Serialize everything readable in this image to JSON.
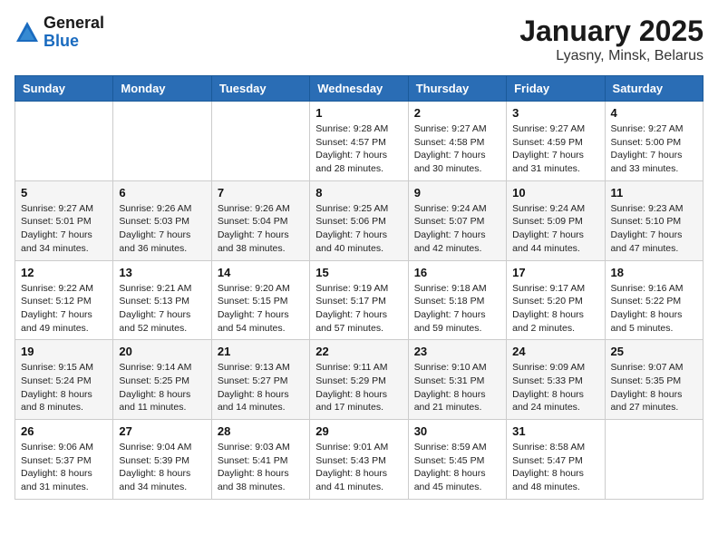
{
  "logo": {
    "general": "General",
    "blue": "Blue"
  },
  "header": {
    "month": "January 2025",
    "location": "Lyasny, Minsk, Belarus"
  },
  "weekdays": [
    "Sunday",
    "Monday",
    "Tuesday",
    "Wednesday",
    "Thursday",
    "Friday",
    "Saturday"
  ],
  "weeks": [
    [
      {
        "day": "",
        "info": ""
      },
      {
        "day": "",
        "info": ""
      },
      {
        "day": "",
        "info": ""
      },
      {
        "day": "1",
        "info": "Sunrise: 9:28 AM\nSunset: 4:57 PM\nDaylight: 7 hours\nand 28 minutes."
      },
      {
        "day": "2",
        "info": "Sunrise: 9:27 AM\nSunset: 4:58 PM\nDaylight: 7 hours\nand 30 minutes."
      },
      {
        "day": "3",
        "info": "Sunrise: 9:27 AM\nSunset: 4:59 PM\nDaylight: 7 hours\nand 31 minutes."
      },
      {
        "day": "4",
        "info": "Sunrise: 9:27 AM\nSunset: 5:00 PM\nDaylight: 7 hours\nand 33 minutes."
      }
    ],
    [
      {
        "day": "5",
        "info": "Sunrise: 9:27 AM\nSunset: 5:01 PM\nDaylight: 7 hours\nand 34 minutes."
      },
      {
        "day": "6",
        "info": "Sunrise: 9:26 AM\nSunset: 5:03 PM\nDaylight: 7 hours\nand 36 minutes."
      },
      {
        "day": "7",
        "info": "Sunrise: 9:26 AM\nSunset: 5:04 PM\nDaylight: 7 hours\nand 38 minutes."
      },
      {
        "day": "8",
        "info": "Sunrise: 9:25 AM\nSunset: 5:06 PM\nDaylight: 7 hours\nand 40 minutes."
      },
      {
        "day": "9",
        "info": "Sunrise: 9:24 AM\nSunset: 5:07 PM\nDaylight: 7 hours\nand 42 minutes."
      },
      {
        "day": "10",
        "info": "Sunrise: 9:24 AM\nSunset: 5:09 PM\nDaylight: 7 hours\nand 44 minutes."
      },
      {
        "day": "11",
        "info": "Sunrise: 9:23 AM\nSunset: 5:10 PM\nDaylight: 7 hours\nand 47 minutes."
      }
    ],
    [
      {
        "day": "12",
        "info": "Sunrise: 9:22 AM\nSunset: 5:12 PM\nDaylight: 7 hours\nand 49 minutes."
      },
      {
        "day": "13",
        "info": "Sunrise: 9:21 AM\nSunset: 5:13 PM\nDaylight: 7 hours\nand 52 minutes."
      },
      {
        "day": "14",
        "info": "Sunrise: 9:20 AM\nSunset: 5:15 PM\nDaylight: 7 hours\nand 54 minutes."
      },
      {
        "day": "15",
        "info": "Sunrise: 9:19 AM\nSunset: 5:17 PM\nDaylight: 7 hours\nand 57 minutes."
      },
      {
        "day": "16",
        "info": "Sunrise: 9:18 AM\nSunset: 5:18 PM\nDaylight: 7 hours\nand 59 minutes."
      },
      {
        "day": "17",
        "info": "Sunrise: 9:17 AM\nSunset: 5:20 PM\nDaylight: 8 hours\nand 2 minutes."
      },
      {
        "day": "18",
        "info": "Sunrise: 9:16 AM\nSunset: 5:22 PM\nDaylight: 8 hours\nand 5 minutes."
      }
    ],
    [
      {
        "day": "19",
        "info": "Sunrise: 9:15 AM\nSunset: 5:24 PM\nDaylight: 8 hours\nand 8 minutes."
      },
      {
        "day": "20",
        "info": "Sunrise: 9:14 AM\nSunset: 5:25 PM\nDaylight: 8 hours\nand 11 minutes."
      },
      {
        "day": "21",
        "info": "Sunrise: 9:13 AM\nSunset: 5:27 PM\nDaylight: 8 hours\nand 14 minutes."
      },
      {
        "day": "22",
        "info": "Sunrise: 9:11 AM\nSunset: 5:29 PM\nDaylight: 8 hours\nand 17 minutes."
      },
      {
        "day": "23",
        "info": "Sunrise: 9:10 AM\nSunset: 5:31 PM\nDaylight: 8 hours\nand 21 minutes."
      },
      {
        "day": "24",
        "info": "Sunrise: 9:09 AM\nSunset: 5:33 PM\nDaylight: 8 hours\nand 24 minutes."
      },
      {
        "day": "25",
        "info": "Sunrise: 9:07 AM\nSunset: 5:35 PM\nDaylight: 8 hours\nand 27 minutes."
      }
    ],
    [
      {
        "day": "26",
        "info": "Sunrise: 9:06 AM\nSunset: 5:37 PM\nDaylight: 8 hours\nand 31 minutes."
      },
      {
        "day": "27",
        "info": "Sunrise: 9:04 AM\nSunset: 5:39 PM\nDaylight: 8 hours\nand 34 minutes."
      },
      {
        "day": "28",
        "info": "Sunrise: 9:03 AM\nSunset: 5:41 PM\nDaylight: 8 hours\nand 38 minutes."
      },
      {
        "day": "29",
        "info": "Sunrise: 9:01 AM\nSunset: 5:43 PM\nDaylight: 8 hours\nand 41 minutes."
      },
      {
        "day": "30",
        "info": "Sunrise: 8:59 AM\nSunset: 5:45 PM\nDaylight: 8 hours\nand 45 minutes."
      },
      {
        "day": "31",
        "info": "Sunrise: 8:58 AM\nSunset: 5:47 PM\nDaylight: 8 hours\nand 48 minutes."
      },
      {
        "day": "",
        "info": ""
      }
    ]
  ]
}
